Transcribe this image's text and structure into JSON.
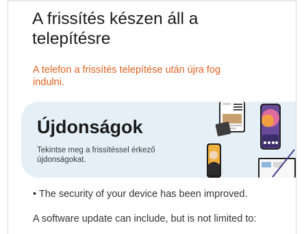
{
  "update": {
    "title": "A frissítés készen áll a telepítésre",
    "restart_note": "A telefon a frissítés telepítése után újra fog indulni."
  },
  "whats_new": {
    "title": "Újdonságok",
    "description": "Tekintse meg a frissítéssel érkező újdonságokat."
  },
  "release_notes": {
    "security_item": "• The security of your device has been improved.",
    "intro": "A software update can include, but is not limited to:"
  },
  "colors": {
    "accent": "#e06120",
    "card_background": "#e4eff7",
    "text": "#1a1a1a"
  }
}
